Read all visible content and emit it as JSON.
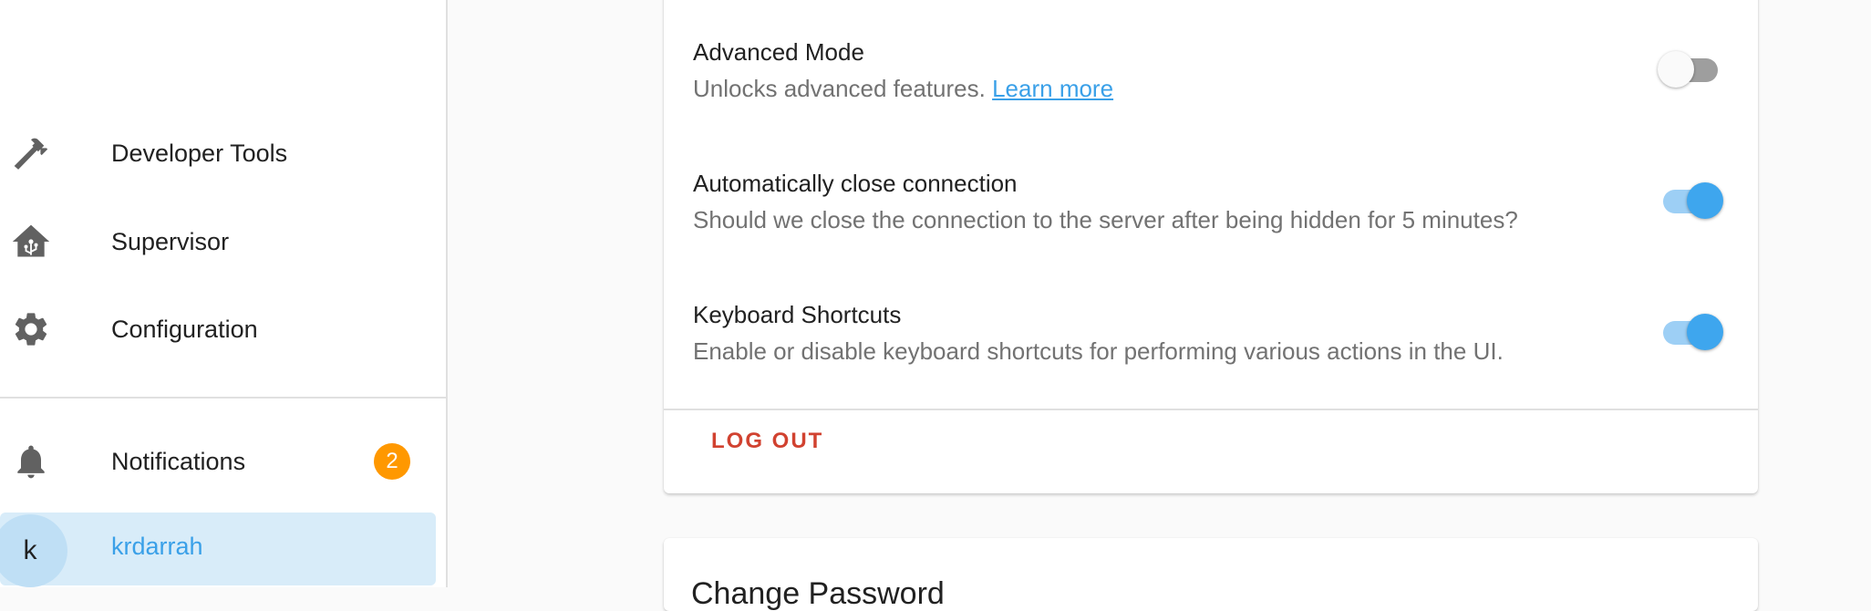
{
  "sidebar": {
    "items": [
      {
        "label": "Developer Tools",
        "icon": "hammer-icon"
      },
      {
        "label": "Supervisor",
        "icon": "home-assistant-icon"
      },
      {
        "label": "Configuration",
        "icon": "gear-icon"
      }
    ],
    "notifications": {
      "label": "Notifications",
      "icon": "bell-icon",
      "count": "2"
    },
    "user": {
      "initial": "k",
      "name": "krdarrah"
    }
  },
  "settings": {
    "advanced_mode": {
      "title": "Advanced Mode",
      "desc": "Unlocks advanced features.",
      "link": "Learn more",
      "enabled": false
    },
    "auto_close": {
      "title": "Automatically close connection",
      "desc": "Should we close the connection to the server after being hidden for 5 minutes?",
      "enabled": true
    },
    "keyboard_shortcuts": {
      "title": "Keyboard Shortcuts",
      "desc": "Enable or disable keyboard shortcuts for performing various actions in the UI.",
      "enabled": true
    },
    "logout_label": "LOG OUT"
  },
  "next_card": {
    "title": "Change Password"
  },
  "colors": {
    "accent": "#3ea6ee",
    "badge": "#ff9800",
    "logout": "#d14230",
    "selected_bg": "#d8ecf9"
  }
}
